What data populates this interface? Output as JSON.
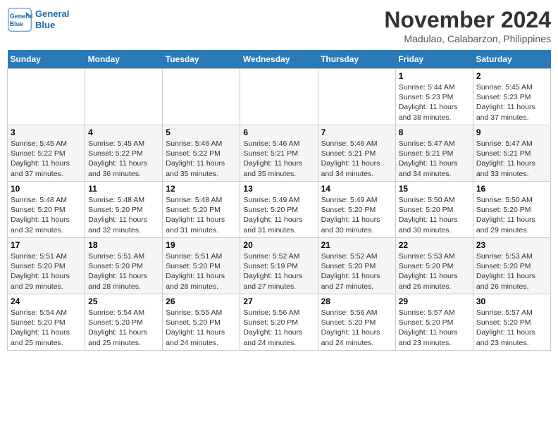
{
  "header": {
    "logo_line1": "General",
    "logo_line2": "Blue",
    "month": "November 2024",
    "location": "Madulao, Calabarzon, Philippines"
  },
  "weekdays": [
    "Sunday",
    "Monday",
    "Tuesday",
    "Wednesday",
    "Thursday",
    "Friday",
    "Saturday"
  ],
  "weeks": [
    [
      {
        "day": "",
        "detail": ""
      },
      {
        "day": "",
        "detail": ""
      },
      {
        "day": "",
        "detail": ""
      },
      {
        "day": "",
        "detail": ""
      },
      {
        "day": "",
        "detail": ""
      },
      {
        "day": "1",
        "detail": "Sunrise: 5:44 AM\nSunset: 5:23 PM\nDaylight: 11 hours\nand 38 minutes."
      },
      {
        "day": "2",
        "detail": "Sunrise: 5:45 AM\nSunset: 5:23 PM\nDaylight: 11 hours\nand 37 minutes."
      }
    ],
    [
      {
        "day": "3",
        "detail": "Sunrise: 5:45 AM\nSunset: 5:22 PM\nDaylight: 11 hours\nand 37 minutes."
      },
      {
        "day": "4",
        "detail": "Sunrise: 5:45 AM\nSunset: 5:22 PM\nDaylight: 11 hours\nand 36 minutes."
      },
      {
        "day": "5",
        "detail": "Sunrise: 5:46 AM\nSunset: 5:22 PM\nDaylight: 11 hours\nand 35 minutes."
      },
      {
        "day": "6",
        "detail": "Sunrise: 5:46 AM\nSunset: 5:21 PM\nDaylight: 11 hours\nand 35 minutes."
      },
      {
        "day": "7",
        "detail": "Sunrise: 5:46 AM\nSunset: 5:21 PM\nDaylight: 11 hours\nand 34 minutes."
      },
      {
        "day": "8",
        "detail": "Sunrise: 5:47 AM\nSunset: 5:21 PM\nDaylight: 11 hours\nand 34 minutes."
      },
      {
        "day": "9",
        "detail": "Sunrise: 5:47 AM\nSunset: 5:21 PM\nDaylight: 11 hours\nand 33 minutes."
      }
    ],
    [
      {
        "day": "10",
        "detail": "Sunrise: 5:48 AM\nSunset: 5:20 PM\nDaylight: 11 hours\nand 32 minutes."
      },
      {
        "day": "11",
        "detail": "Sunrise: 5:48 AM\nSunset: 5:20 PM\nDaylight: 11 hours\nand 32 minutes."
      },
      {
        "day": "12",
        "detail": "Sunrise: 5:48 AM\nSunset: 5:20 PM\nDaylight: 11 hours\nand 31 minutes."
      },
      {
        "day": "13",
        "detail": "Sunrise: 5:49 AM\nSunset: 5:20 PM\nDaylight: 11 hours\nand 31 minutes."
      },
      {
        "day": "14",
        "detail": "Sunrise: 5:49 AM\nSunset: 5:20 PM\nDaylight: 11 hours\nand 30 minutes."
      },
      {
        "day": "15",
        "detail": "Sunrise: 5:50 AM\nSunset: 5:20 PM\nDaylight: 11 hours\nand 30 minutes."
      },
      {
        "day": "16",
        "detail": "Sunrise: 5:50 AM\nSunset: 5:20 PM\nDaylight: 11 hours\nand 29 minutes."
      }
    ],
    [
      {
        "day": "17",
        "detail": "Sunrise: 5:51 AM\nSunset: 5:20 PM\nDaylight: 11 hours\nand 29 minutes."
      },
      {
        "day": "18",
        "detail": "Sunrise: 5:51 AM\nSunset: 5:20 PM\nDaylight: 11 hours\nand 28 minutes."
      },
      {
        "day": "19",
        "detail": "Sunrise: 5:51 AM\nSunset: 5:20 PM\nDaylight: 11 hours\nand 28 minutes."
      },
      {
        "day": "20",
        "detail": "Sunrise: 5:52 AM\nSunset: 5:19 PM\nDaylight: 11 hours\nand 27 minutes."
      },
      {
        "day": "21",
        "detail": "Sunrise: 5:52 AM\nSunset: 5:20 PM\nDaylight: 11 hours\nand 27 minutes."
      },
      {
        "day": "22",
        "detail": "Sunrise: 5:53 AM\nSunset: 5:20 PM\nDaylight: 11 hours\nand 26 minutes."
      },
      {
        "day": "23",
        "detail": "Sunrise: 5:53 AM\nSunset: 5:20 PM\nDaylight: 11 hours\nand 26 minutes."
      }
    ],
    [
      {
        "day": "24",
        "detail": "Sunrise: 5:54 AM\nSunset: 5:20 PM\nDaylight: 11 hours\nand 25 minutes."
      },
      {
        "day": "25",
        "detail": "Sunrise: 5:54 AM\nSunset: 5:20 PM\nDaylight: 11 hours\nand 25 minutes."
      },
      {
        "day": "26",
        "detail": "Sunrise: 5:55 AM\nSunset: 5:20 PM\nDaylight: 11 hours\nand 24 minutes."
      },
      {
        "day": "27",
        "detail": "Sunrise: 5:56 AM\nSunset: 5:20 PM\nDaylight: 11 hours\nand 24 minutes."
      },
      {
        "day": "28",
        "detail": "Sunrise: 5:56 AM\nSunset: 5:20 PM\nDaylight: 11 hours\nand 24 minutes."
      },
      {
        "day": "29",
        "detail": "Sunrise: 5:57 AM\nSunset: 5:20 PM\nDaylight: 11 hours\nand 23 minutes."
      },
      {
        "day": "30",
        "detail": "Sunrise: 5:57 AM\nSunset: 5:20 PM\nDaylight: 11 hours\nand 23 minutes."
      }
    ]
  ]
}
